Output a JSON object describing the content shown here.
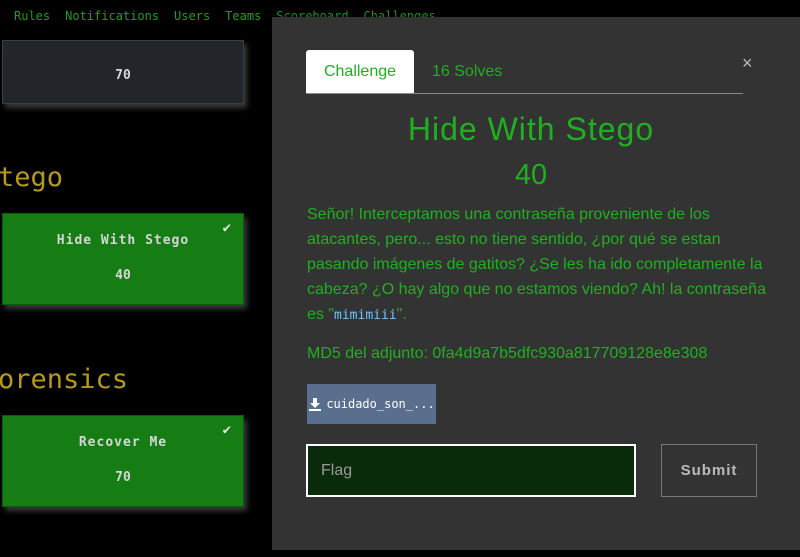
{
  "nav": {
    "items": [
      {
        "label": "Rules"
      },
      {
        "label": "Notifications"
      },
      {
        "label": "Users"
      },
      {
        "label": "Teams"
      },
      {
        "label": "Scoreboard"
      },
      {
        "label": "Challenges"
      }
    ]
  },
  "board": {
    "top_card": {
      "value": "70"
    },
    "categories": [
      {
        "title": "tego",
        "cards": [
          {
            "name": "Hide With Stego",
            "value": "40",
            "solved": true
          }
        ]
      },
      {
        "title": "orensics",
        "cards": [
          {
            "name": "Recover Me",
            "value": "70",
            "solved": true
          }
        ]
      }
    ]
  },
  "modal": {
    "close": "×",
    "tabs": {
      "challenge": "Challenge",
      "solves": "16 Solves"
    },
    "name": "Hide With Stego",
    "value": "40",
    "description": "Señor! Interceptamos una contraseña proveniente de los atacantes, pero... esto no tiene sentido, ¿por qué se estan pasando imágenes de gatitos? ¿Se les ha ido completamente la cabeza? ¿O hay algo que no estamos viendo? Ah! la contraseña es \"",
    "password": "mimimiii",
    "description_end": "\".",
    "md5": "MD5 del adjunto: 0fa4d9a7b5dfc930a817709128e8e308",
    "file": {
      "label": "cuidado_son_...",
      "icon": "download-icon"
    },
    "flag": {
      "placeholder": "Flag",
      "value": ""
    },
    "submit": "Submit"
  },
  "colors": {
    "accent": "#1fb01f",
    "solved_card": "#157d14",
    "modal_bg": "#333333",
    "category": "#b59a1a"
  }
}
